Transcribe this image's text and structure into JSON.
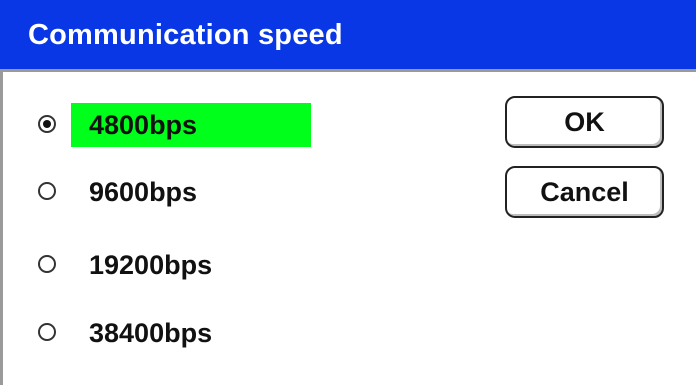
{
  "dialog": {
    "title": "Communication speed"
  },
  "options": [
    {
      "label": "4800bps",
      "selected": true
    },
    {
      "label": "9600bps",
      "selected": false
    },
    {
      "label": "19200bps",
      "selected": false
    },
    {
      "label": "38400bps",
      "selected": false
    }
  ],
  "buttons": {
    "ok_label": "OK",
    "cancel_label": "Cancel"
  },
  "colors": {
    "titlebar": "#0a37e6",
    "selection_highlight": "#00ff1a"
  }
}
